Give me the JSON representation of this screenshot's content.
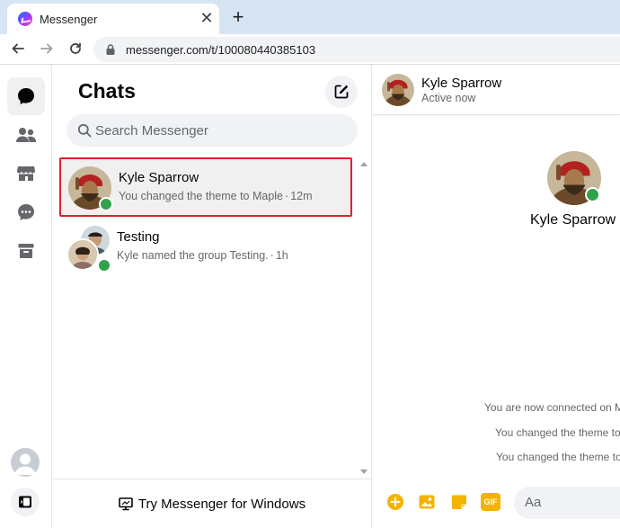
{
  "browser": {
    "tab_title": "Messenger",
    "tab_close": "✕",
    "new_tab": "+",
    "url": "messenger.com/t/100080440385103"
  },
  "rail": {
    "icons": [
      "chats-icon",
      "people-icon",
      "marketplace-icon",
      "requests-icon",
      "archive-icon"
    ]
  },
  "chatlist": {
    "title": "Chats",
    "search_placeholder": "Search Messenger",
    "conversations": [
      {
        "name": "Kyle Sparrow",
        "snippet": "You changed the theme to Maple",
        "time": "12m",
        "selected": true,
        "online": true
      },
      {
        "name": "Testing",
        "snippet": "Kyle named the group Testing.",
        "time": "1h",
        "selected": false,
        "online": true
      }
    ],
    "try_windows": "Try Messenger for Windows"
  },
  "conversation": {
    "name": "Kyle Sparrow",
    "status": "Active now",
    "profile_name": "Kyle Sparrow",
    "system_messages": [
      "You are now connected on M",
      "You changed the theme to",
      "You changed the theme to"
    ],
    "composer_placeholder": "Aa",
    "gif_label": "GIF"
  },
  "colors": {
    "accent": "#f5b300",
    "online": "#31a24c",
    "selected_outline": "#e0222a"
  }
}
